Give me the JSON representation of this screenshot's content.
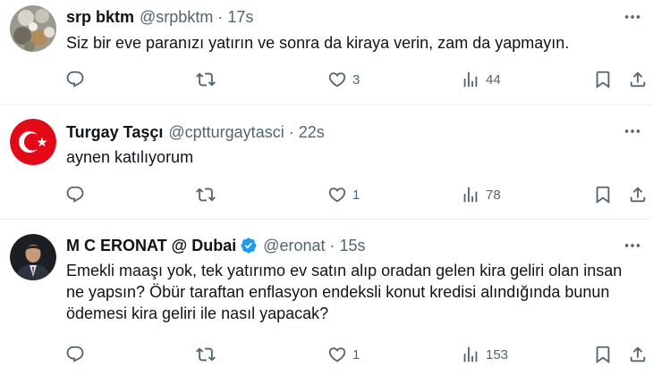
{
  "tweets": [
    {
      "name": "srp bktm",
      "handle": "@srpbktm",
      "separator": "·",
      "time": "17s",
      "text": "Siz bir eve paranızı yatırın ve sonra da kiraya verin, zam da yapmayın.",
      "reply_count": "",
      "retweet_count": "",
      "like_count": "3",
      "view_count": "44"
    },
    {
      "name": "Turgay Taşçı",
      "handle": "@cptturgaytasci",
      "separator": "·",
      "time": "22s",
      "text": "aynen katılıyorum",
      "reply_count": "",
      "retweet_count": "",
      "like_count": "1",
      "view_count": "78"
    },
    {
      "name": "M C ERONAT @ Dubai",
      "handle": "@eronat",
      "separator": "·",
      "time": "15s",
      "text": "Emekli maaşı yok, tek yatırımo ev satın alıp oradan gelen kira geliri olan insan ne yapsın? Öbür taraftan enflasyon endeksli konut kredisi alındığında bunun ödemesi kira geliri ile nasıl yapacak?",
      "reply_count": "",
      "retweet_count": "",
      "like_count": "1",
      "view_count": "153"
    }
  ],
  "colors": {
    "text_primary": "#0f1419",
    "text_secondary": "#536471",
    "verified_blue": "#1d9bf0",
    "divider": "#eff3f4",
    "flag_red": "#e30a17"
  },
  "icons": [
    "reply-icon",
    "retweet-icon",
    "like-icon",
    "views-icon",
    "bookmark-icon",
    "share-icon",
    "more-icon",
    "verified-icon"
  ]
}
